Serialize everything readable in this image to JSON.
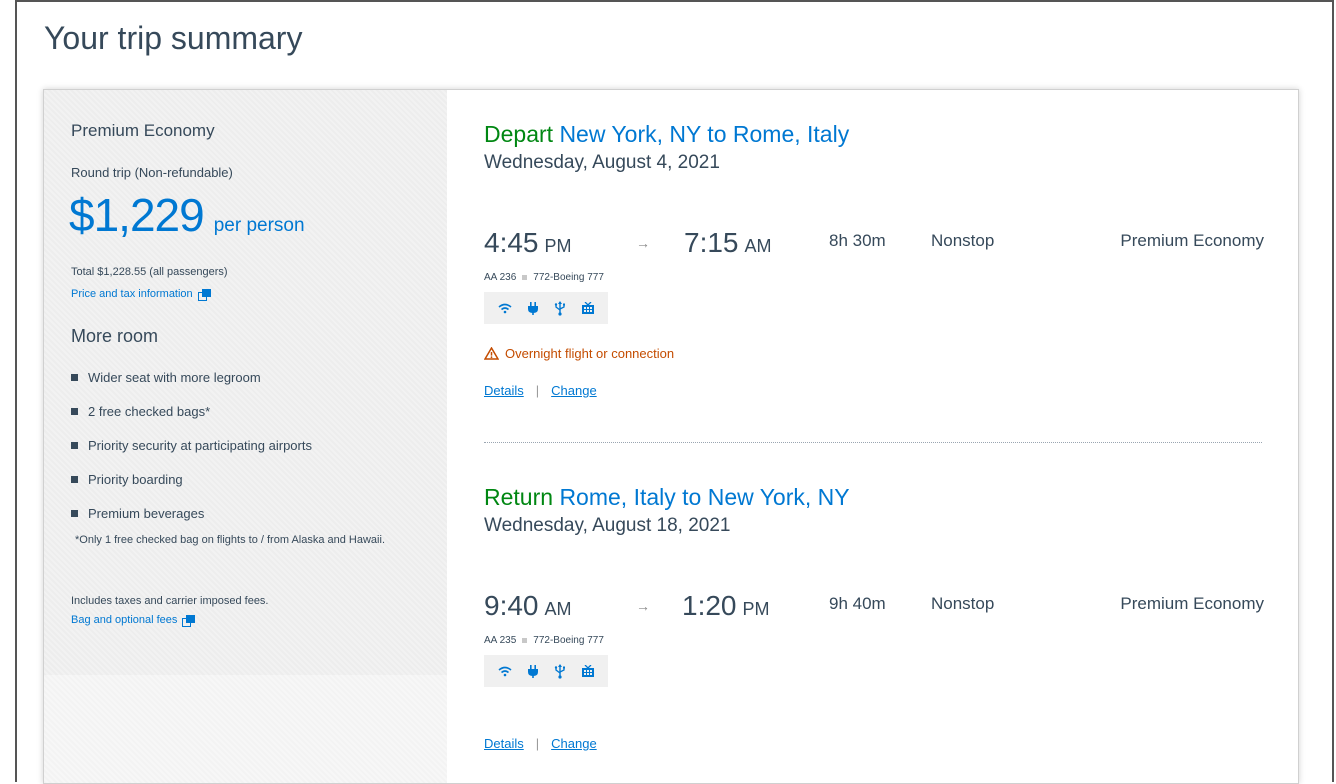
{
  "page": {
    "title": "Your trip summary"
  },
  "summary": {
    "cabin": "Premium Economy",
    "trip_type": "Round trip (Non-refundable)",
    "price": "$1,229",
    "price_unit": "per person",
    "total": "Total $1,228.55 (all passengers)",
    "price_tax_link": "Price and tax information",
    "more_room_title": "More room",
    "benefits": [
      "Wider seat with more legroom",
      "2 free checked bags*",
      "Priority security at participating airports",
      "Priority boarding",
      "Premium beverages"
    ],
    "footnote": "*Only 1 free checked bag on flights to / from Alaska and Hawaii.",
    "includes": "Includes taxes and carrier imposed fees.",
    "bag_fees_link": "Bag and optional fees"
  },
  "segments": [
    {
      "lead": "Depart",
      "route": "New York, NY to Rome, Italy",
      "date": "Wednesday, August 4, 2021",
      "depart_time": "4:45",
      "depart_ampm": "PM",
      "arrive_time": "7:15",
      "arrive_ampm": "AM",
      "duration": "8h 30m",
      "stops": "Nonstop",
      "cabin": "Premium Economy",
      "flight": "AA 236",
      "aircraft": "772-Boeing 777",
      "warning": "Overnight flight or connection",
      "details_link": "Details",
      "change_link": "Change"
    },
    {
      "lead": "Return",
      "route": "Rome, Italy to New York, NY",
      "date": "Wednesday, August 18, 2021",
      "depart_time": "9:40",
      "depart_ampm": "AM",
      "arrive_time": "1:20",
      "arrive_ampm": "PM",
      "duration": "9h 40m",
      "stops": "Nonstop",
      "cabin": "Premium Economy",
      "flight": "AA 235",
      "aircraft": "772-Boeing 777",
      "details_link": "Details",
      "change_link": "Change"
    }
  ],
  "amenity_icons": [
    "wifi-icon",
    "power-icon",
    "usb-icon",
    "entertainment-icon"
  ],
  "colors": {
    "link": "#0078d2",
    "lead": "#008712",
    "warning": "#c44c00",
    "text": "#36495a"
  }
}
